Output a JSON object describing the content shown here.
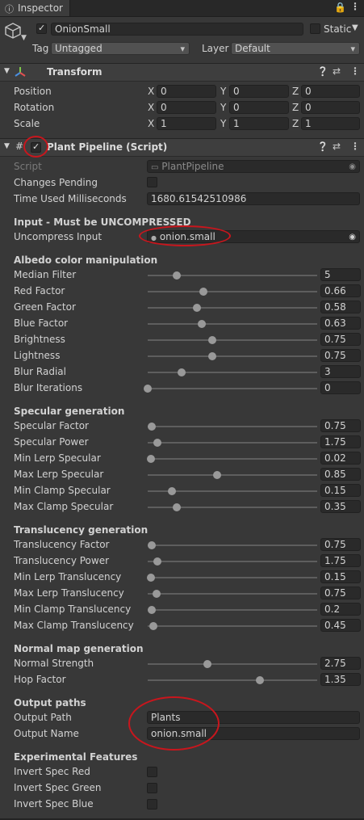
{
  "window": {
    "tab_label": "Inspector",
    "lock_icon": "lock-icon",
    "menu_icon": "kebab-menu-icon"
  },
  "object": {
    "name": "OnionSmall",
    "active": true,
    "static_label": "Static",
    "static_checked": false,
    "tag_label": "Tag",
    "tag_value": "Untagged",
    "layer_label": "Layer",
    "layer_value": "Default"
  },
  "transform": {
    "title": "Transform",
    "rows": [
      {
        "label": "Position",
        "x": "0",
        "y": "0",
        "z": "0"
      },
      {
        "label": "Rotation",
        "x": "0",
        "y": "0",
        "z": "0"
      },
      {
        "label": "Scale",
        "x": "1",
        "y": "1",
        "z": "1"
      }
    ],
    "axis": {
      "x": "X",
      "y": "Y",
      "z": "Z"
    }
  },
  "plant": {
    "title": "Plant Pipeline (Script)",
    "enabled": true,
    "script_label": "Script",
    "script_value": "PlantPipeline",
    "changes_label": "Changes Pending",
    "changes_checked": false,
    "time_label": "Time Used Milliseconds",
    "time_value": "1680.61542510986",
    "input_section": "Input - Must be UNCOMPRESSED",
    "uncompress_label": "Uncompress Input",
    "uncompress_value": "onion.small",
    "albedo_section": "Albedo color manipulation",
    "albedo": [
      {
        "label": "Median Filter",
        "value": "5",
        "fill": 0.17
      },
      {
        "label": "Red Factor",
        "value": "0.66",
        "fill": 0.33
      },
      {
        "label": "Green Factor",
        "value": "0.58",
        "fill": 0.29
      },
      {
        "label": "Blue Factor",
        "value": "0.63",
        "fill": 0.32
      },
      {
        "label": "Brightness",
        "value": "0.75",
        "fill": 0.38
      },
      {
        "label": "Lightness",
        "value": "0.75",
        "fill": 0.38
      },
      {
        "label": "Blur Radial",
        "value": "3",
        "fill": 0.2
      },
      {
        "label": "Blur Iterations",
        "value": "0",
        "fill": 0.0
      }
    ],
    "specular_section": "Specular generation",
    "specular": [
      {
        "label": "Specular Factor",
        "value": "0.75",
        "fill": 0.025
      },
      {
        "label": "Specular Power",
        "value": "1.75",
        "fill": 0.055
      },
      {
        "label": "Min Lerp Specular",
        "value": "0.02",
        "fill": 0.02
      },
      {
        "label": "Max Lerp Specular",
        "value": "0.85",
        "fill": 0.41
      },
      {
        "label": "Min Clamp Specular",
        "value": "0.15",
        "fill": 0.145
      },
      {
        "label": "Max Clamp Specular",
        "value": "0.35",
        "fill": 0.17
      }
    ],
    "translucency_section": "Translucency generation",
    "translucency": [
      {
        "label": "Translucency Factor",
        "value": "0.75",
        "fill": 0.025
      },
      {
        "label": "Translucency Power",
        "value": "1.75",
        "fill": 0.055
      },
      {
        "label": "Min Lerp Translucency",
        "value": "0.15",
        "fill": 0.02
      },
      {
        "label": "Max Lerp Translucency",
        "value": "0.75",
        "fill": 0.05
      },
      {
        "label": "Min Clamp Translucency",
        "value": "0.2",
        "fill": 0.025
      },
      {
        "label": "Max Clamp Translucency",
        "value": "0.45",
        "fill": 0.035
      }
    ],
    "normal_section": "Normal map generation",
    "normal": [
      {
        "label": "Normal Strength",
        "value": "2.75",
        "fill": 0.35
      },
      {
        "label": "Hop Factor",
        "value": "1.35",
        "fill": 0.66
      }
    ],
    "output_section": "Output paths",
    "output_path_label": "Output Path",
    "output_path_value": "Plants",
    "output_name_label": "Output Name",
    "output_name_value": "onion.small",
    "experimental_section": "Experimental Features",
    "experimental": [
      {
        "label": "Invert Spec Red",
        "checked": false
      },
      {
        "label": "Invert Spec Green",
        "checked": false
      },
      {
        "label": "Invert Spec Blue",
        "checked": false
      }
    ]
  },
  "colors": {
    "annotation": "#c8161d",
    "background": "#383838",
    "header": "#3e3e3e"
  }
}
